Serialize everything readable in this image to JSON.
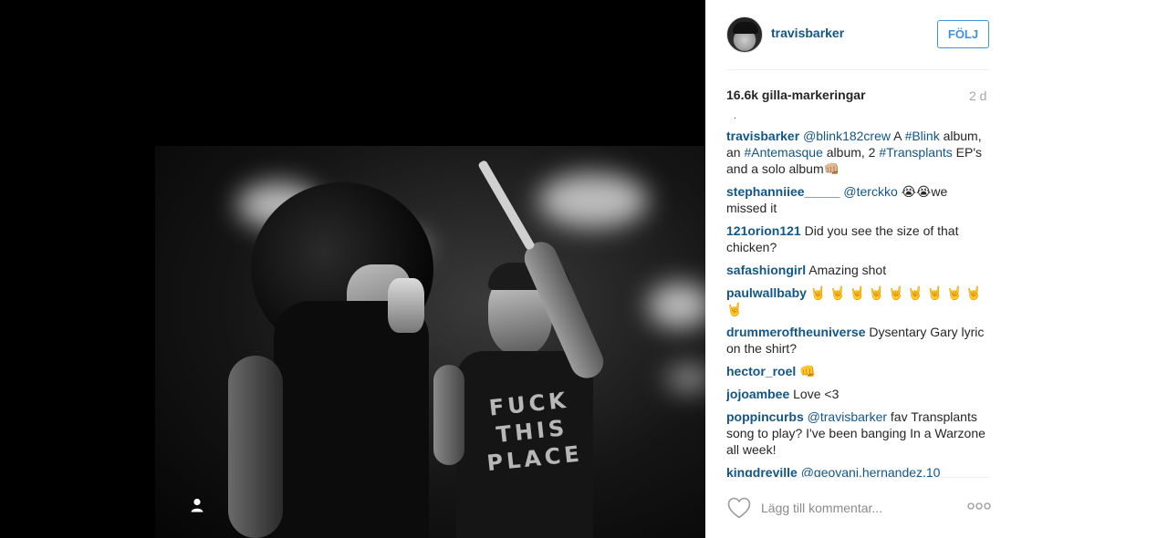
{
  "post": {
    "username": "travisbarker",
    "follow_label": "FÖLJ",
    "likes": "16.6k gilla-markeringar",
    "time": "2 d",
    "dot": ".",
    "comment_placeholder": "Lägg till kommentar...",
    "photo_text": "FUCK THIS PLACE"
  },
  "comments": [
    {
      "user": "travisbarker",
      "mention": "@blink182crew",
      "text": " A ",
      "mention2": "#Blink",
      "text2": " album, an ",
      "mention3": "#Antemasque",
      "text3": " album, 2 ",
      "mention4": "#Transplants",
      "text4": " EP's and a solo album👊🏼"
    },
    {
      "user": "stephanniiee_____",
      "mention": "@terckko",
      "text": " 😭😭we missed it"
    },
    {
      "user": "121orion121",
      "text": " Did you see the size of that chicken?"
    },
    {
      "user": "safashiongirl",
      "text": " Amazing shot"
    },
    {
      "user": "paulwallbaby",
      "text": " 🤘 🤘 🤘 🤘 🤘 🤘 🤘 🤘 🤘 🤘"
    },
    {
      "user": "drummeroftheuniverse",
      "text": " Dysentary Gary lyric on the shirt?"
    },
    {
      "user": "hector_roel",
      "text": " 👊"
    },
    {
      "user": "jojoambee",
      "text": " Love <3"
    },
    {
      "user": "poppincurbs",
      "mention": "@travisbarker",
      "text": " fav Transplants song to play? I've been banging In a Warzone all week!"
    },
    {
      "user": "kingdreville",
      "mention": "@geovani.hernandez.10"
    }
  ],
  "icons": {
    "heart": "heart-icon",
    "more": "more-options-icon",
    "user_tag": "user-tag-icon"
  },
  "colors": {
    "link": "#125688",
    "follow": "#4090db",
    "muted": "#a5a7aa"
  }
}
